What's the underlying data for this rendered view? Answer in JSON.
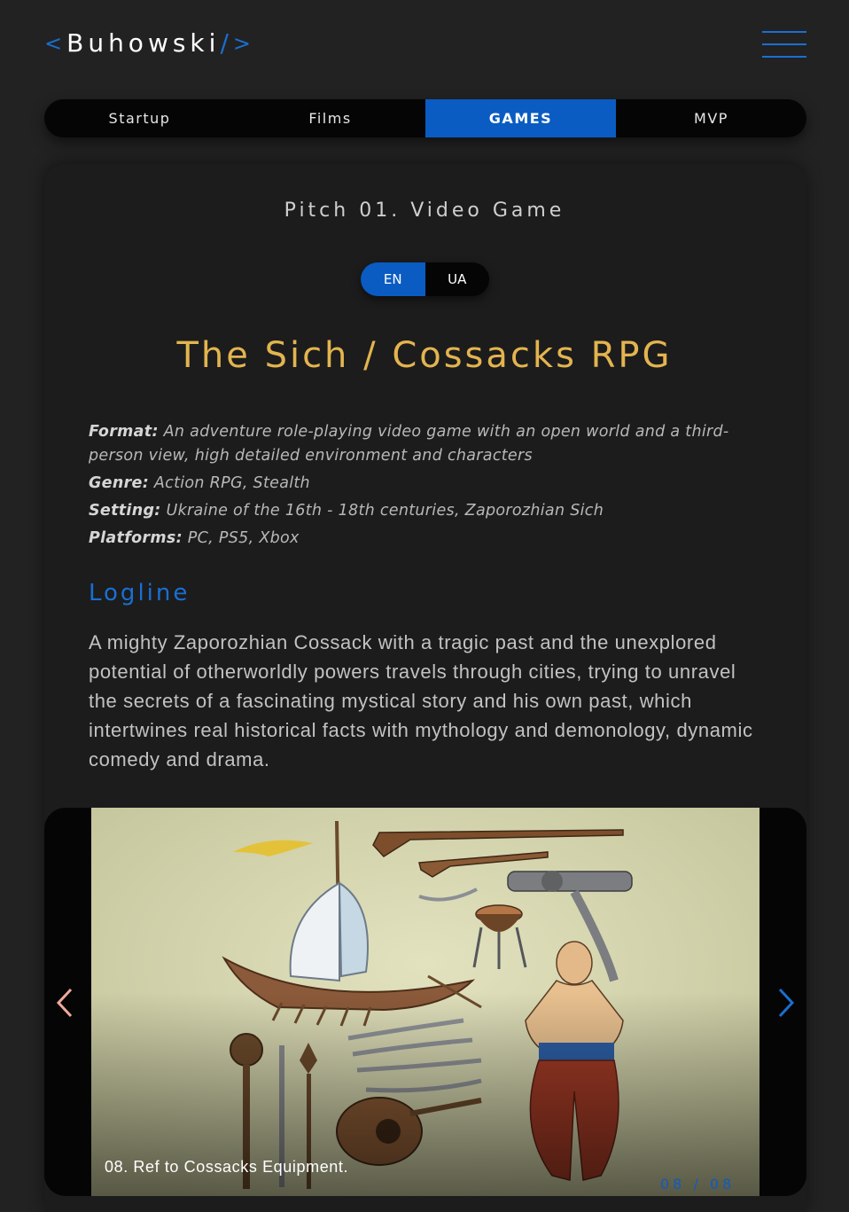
{
  "header": {
    "logo_open": "<",
    "logo_text": "Buhowski",
    "logo_slash": "/",
    "logo_close": ">",
    "menu_icon": "hamburger-icon"
  },
  "tabs": [
    {
      "label": "Startup",
      "active": false
    },
    {
      "label": "Films",
      "active": false
    },
    {
      "label": "GAMES",
      "active": true
    },
    {
      "label": "MVP",
      "active": false
    }
  ],
  "pitch": {
    "subtitle": "Pitch 01. Video Game",
    "languages": [
      {
        "label": "EN",
        "active": true
      },
      {
        "label": "UA",
        "active": false
      }
    ],
    "title": "The Sich / Cossacks RPG",
    "details": [
      {
        "key": "Format:",
        "value": "An adventure role-playing video game with an open world and a third-person view, high detailed environment and characters"
      },
      {
        "key": "Genre:",
        "value": "Action RPG, Stealth"
      },
      {
        "key": "Setting:",
        "value": "Ukraine of the 16th - 18th centuries, Zaporozhian Sich"
      },
      {
        "key": "Platforms:",
        "value": "PC, PS5, Xbox"
      }
    ],
    "logline_heading": "Logline",
    "logline_text": "A mighty Zaporozhian Cossack with a tragic past and the unexplored potential of otherworldly powers travels through cities, trying to unravel the secrets of a fascinating mystical story and his own past, which intertwines real historical facts with mythology and demonology, dynamic comedy and drama."
  },
  "slider": {
    "caption": "08. Ref to Cossacks Equipment.",
    "counter": "08 / 08",
    "prev_icon": "chevron-left-icon",
    "next_icon": "chevron-right-icon"
  },
  "colors": {
    "accent": "#0a5cc2",
    "title_gold": "#e3b44f",
    "background": "#222223"
  }
}
